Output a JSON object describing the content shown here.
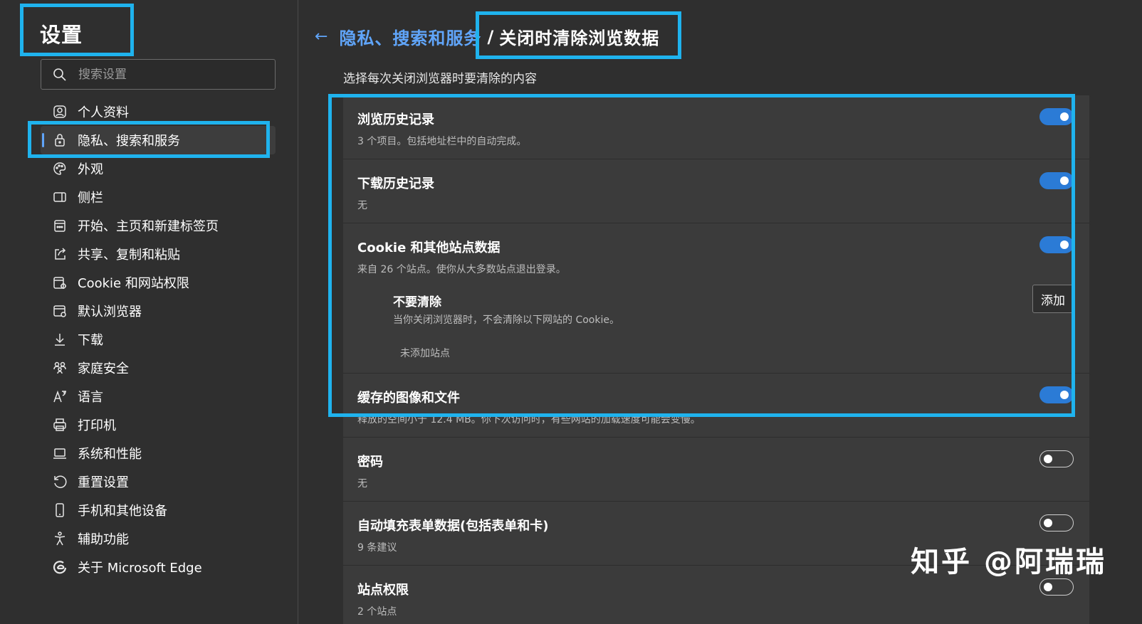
{
  "sidebar": {
    "title": "设置",
    "search_placeholder": "搜索设置",
    "items": [
      {
        "label": "个人资料",
        "icon": "profile-icon"
      },
      {
        "label": "隐私、搜索和服务",
        "icon": "lock-icon",
        "active": true
      },
      {
        "label": "外观",
        "icon": "palette-icon"
      },
      {
        "label": "侧栏",
        "icon": "sidebar-icon"
      },
      {
        "label": "开始、主页和新建标签页",
        "icon": "home-tab-icon"
      },
      {
        "label": "共享、复制和粘贴",
        "icon": "share-icon"
      },
      {
        "label": "Cookie 和网站权限",
        "icon": "cookie-site-icon"
      },
      {
        "label": "默认浏览器",
        "icon": "browser-icon"
      },
      {
        "label": "下载",
        "icon": "download-icon"
      },
      {
        "label": "家庭安全",
        "icon": "family-icon"
      },
      {
        "label": "语言",
        "icon": "language-icon"
      },
      {
        "label": "打印机",
        "icon": "printer-icon"
      },
      {
        "label": "系统和性能",
        "icon": "laptop-icon"
      },
      {
        "label": "重置设置",
        "icon": "reset-icon"
      },
      {
        "label": "手机和其他设备",
        "icon": "phone-icon"
      },
      {
        "label": "辅助功能",
        "icon": "accessibility-icon"
      },
      {
        "label": "关于 Microsoft Edge",
        "icon": "edge-icon"
      }
    ]
  },
  "header": {
    "back_icon": "back-arrow-icon",
    "breadcrumb_parent": "隐私、搜索和服务",
    "breadcrumb_separator": "/",
    "breadcrumb_current": "关闭时清除浏览数据"
  },
  "subtitle": "选择每次关闭浏览器时要清除的内容",
  "options": [
    {
      "title": "浏览历史记录",
      "desc": "3 个项目。包括地址栏中的自动完成。",
      "on": true
    },
    {
      "title": "下载历史记录",
      "desc": "无",
      "on": true
    },
    {
      "title": "Cookie 和其他站点数据",
      "desc": "来自 26 个站点。使你从大多数站点退出登录。",
      "on": true
    },
    {
      "title": "缓存的图像和文件",
      "desc": "释放的空间小于 12.4 MB。你下次访问时，有些网站的加载速度可能会变慢。",
      "on": true
    },
    {
      "title": "密码",
      "desc": "无",
      "on": false
    },
    {
      "title": "自动填充表单数据(包括表单和卡)",
      "desc": "9 条建议",
      "on": false
    },
    {
      "title": "站点权限",
      "desc": "2 个站点",
      "on": false
    }
  ],
  "do_not_clear": {
    "title": "不要清除",
    "desc": "当你关闭浏览器时，不会清除以下网站的 Cookie。",
    "add_label": "添加",
    "empty_text": "未添加站点"
  },
  "watermark": "知乎 @阿瑞瑞",
  "colors": {
    "accent": "#60a5fa",
    "toggle_on": "#2b7bd6",
    "highlight_box": "#1fb3ee",
    "background": "#2f2f2f",
    "card": "#3b3b3b"
  }
}
